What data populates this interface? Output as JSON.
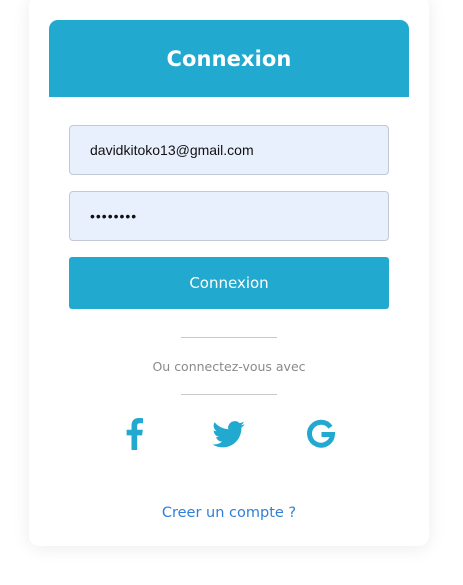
{
  "login": {
    "title": "Connexion",
    "email_value": "davidkitoko13@gmail.com",
    "password_value": "12345678",
    "submit_label": "Connexion",
    "alt_text": "Ou connectez-vous avec",
    "signup_link": "Creer un compte ?"
  },
  "social": [
    "facebook-icon",
    "twitter-icon",
    "google-icon"
  ],
  "colors": {
    "accent": "#22a9cf",
    "link": "#2f7fd6",
    "input_bg": "#e8f0fe",
    "muted_text": "#8a8a8a"
  }
}
